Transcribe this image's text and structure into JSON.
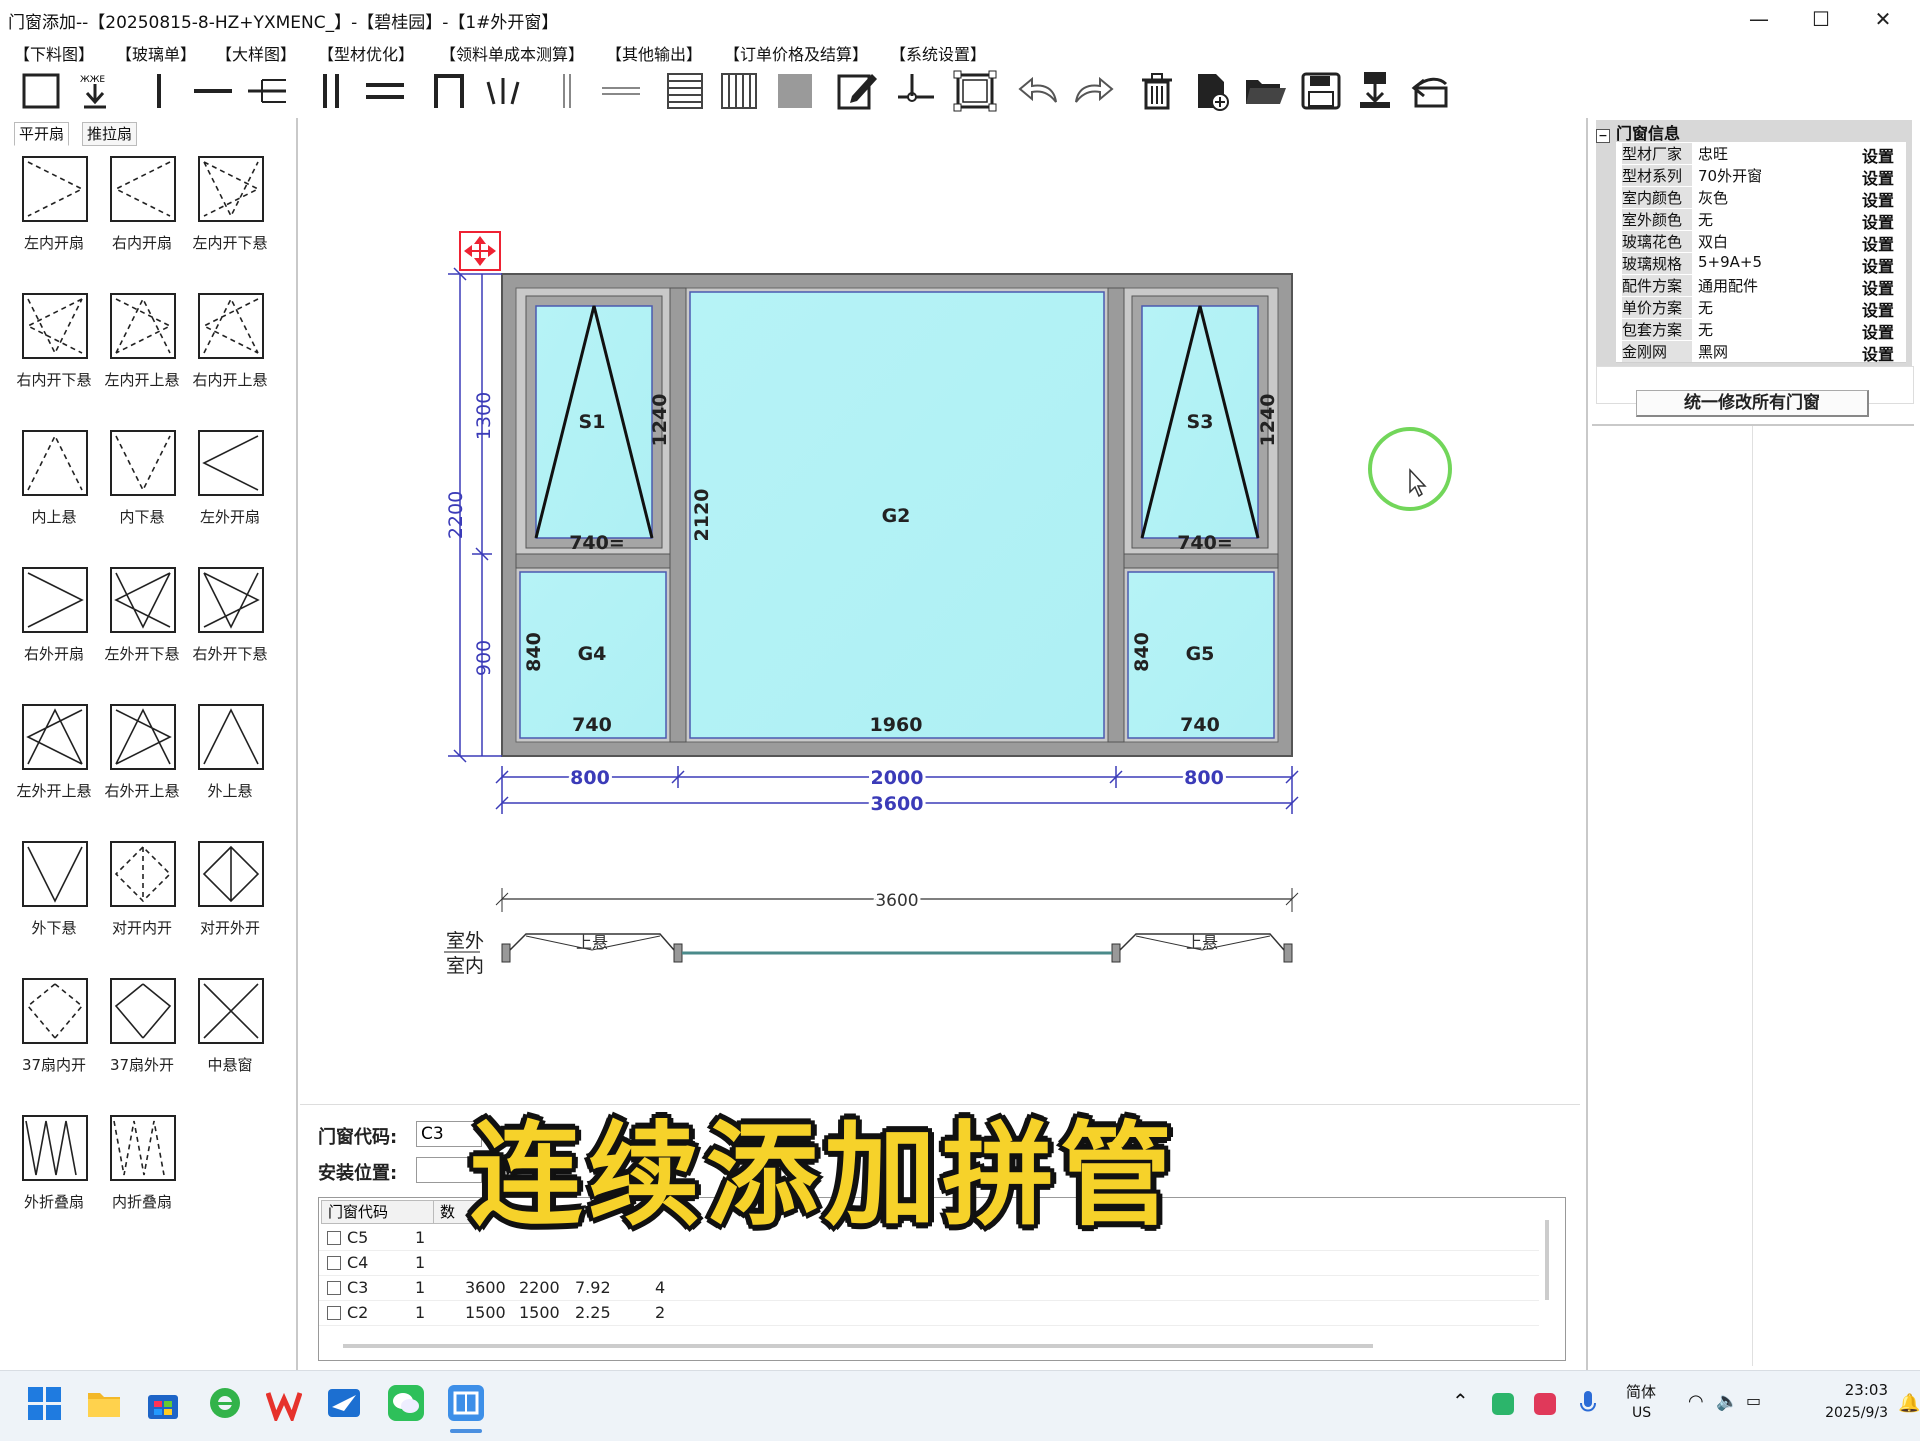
{
  "window": {
    "title": "门窗添加--【20250815-8-HZ+YXMENC_】-【碧桂园】-【1#外开窗】",
    "minimize": "—",
    "maximize": "☐",
    "close": "✕"
  },
  "menu": [
    "【下料图】",
    "【玻璃单】",
    "【大样图】",
    "【型材优化】",
    "【领料单成本测算】",
    "【其他输出】",
    "【订单价格及结算】",
    "【系统设置】"
  ],
  "toolbar_icons": [
    "frame-icon",
    "insert-icon",
    "vertical-mullion-icon",
    "horizontal-mullion-icon",
    "t-mullion-icon",
    "double-vertical-icon",
    "double-horizontal-icon",
    "door-frame-icon",
    "fan-icon",
    "vertical-line-icon",
    "horizontal-line-icon",
    "horizontal-grid-icon",
    "vertical-grid-icon",
    "fill-icon",
    "edit-icon",
    "node-icon",
    "select-frame-icon",
    "undo-icon",
    "redo-icon",
    "delete-icon",
    "new-file-icon",
    "open-folder-icon",
    "save-icon",
    "import-icon",
    "exit-icon"
  ],
  "left_tabs": [
    "平开扇",
    "推拉扇"
  ],
  "sash_types": [
    "左内开扇",
    "右内开扇",
    "左内开下悬",
    "右内开下悬",
    "左内开上悬",
    "右内开上悬",
    "内上悬",
    "内下悬",
    "左外开扇",
    "右外开扇",
    "左外开下悬",
    "右外开下悬",
    "左外开上悬",
    "右外开上悬",
    "外上悬",
    "外下悬",
    "对开内开",
    "对开外开",
    "37扇内开",
    "37扇外开",
    "中悬窗",
    "外折叠扇",
    "内折叠扇"
  ],
  "drawing": {
    "panes": {
      "s1": "S1",
      "s3": "S3",
      "g2": "G2",
      "g4": "G4",
      "g5": "G5"
    },
    "dims": {
      "s1_h": "1240",
      "s3_h": "1240",
      "s1_w": "740=",
      "s3_w": "740=",
      "g2_h": "2120",
      "g4_h": "840",
      "g5_h": "840",
      "g4_w": "740",
      "g2_w": "1960",
      "g5_w": "740",
      "top_h": "1300",
      "bottom_h": "900",
      "total_h": "2200",
      "w_left": "800",
      "w_mid": "2000",
      "w_right": "800",
      "total_w": "3600",
      "plan_w": "3600"
    },
    "section": {
      "outside": "室外",
      "inside": "室内",
      "left_sash": "上悬",
      "right_sash": "上悬"
    }
  },
  "properties": {
    "header": "门窗信息",
    "rows": [
      {
        "key": "型材厂家",
        "value": "忠旺",
        "btn": "设置"
      },
      {
        "key": "型材系列",
        "value": "70外开窗",
        "btn": "设置"
      },
      {
        "key": "室内颜色",
        "value": "灰色",
        "btn": "设置"
      },
      {
        "key": "室外颜色",
        "value": "无",
        "btn": "设置"
      },
      {
        "key": "玻璃花色",
        "value": "双白",
        "btn": "设置"
      },
      {
        "key": "玻璃规格",
        "value": "5+9A+5",
        "btn": "设置"
      },
      {
        "key": "配件方案",
        "value": "通用配件",
        "btn": "设置"
      },
      {
        "key": "单价方案",
        "value": "无",
        "btn": "设置"
      },
      {
        "key": "包套方案",
        "value": "无",
        "btn": "设置"
      },
      {
        "key": "金刚网",
        "value": "黑网",
        "btn": "设置"
      }
    ],
    "apply_all": "统一修改所有门窗"
  },
  "form": {
    "code_label": "门窗代码:",
    "code_value": "C3",
    "location_label": "安装位置:",
    "location_value": ""
  },
  "table": {
    "headers": [
      "门窗代码",
      "数"
    ],
    "rows": [
      [
        "C5",
        "1",
        "",
        "",
        "",
        ""
      ],
      [
        "C4",
        "1",
        "",
        "",
        "",
        ""
      ],
      [
        "C3",
        "1",
        "3600",
        "2200",
        "7.92",
        "4"
      ],
      [
        "C2",
        "1",
        "1500",
        "1500",
        "2.25",
        "2"
      ]
    ]
  },
  "caption": "连续添加拼管",
  "taskbar": {
    "ime": "简体",
    "locale": "US",
    "time": "23:03",
    "date": "2025/9/3"
  }
}
